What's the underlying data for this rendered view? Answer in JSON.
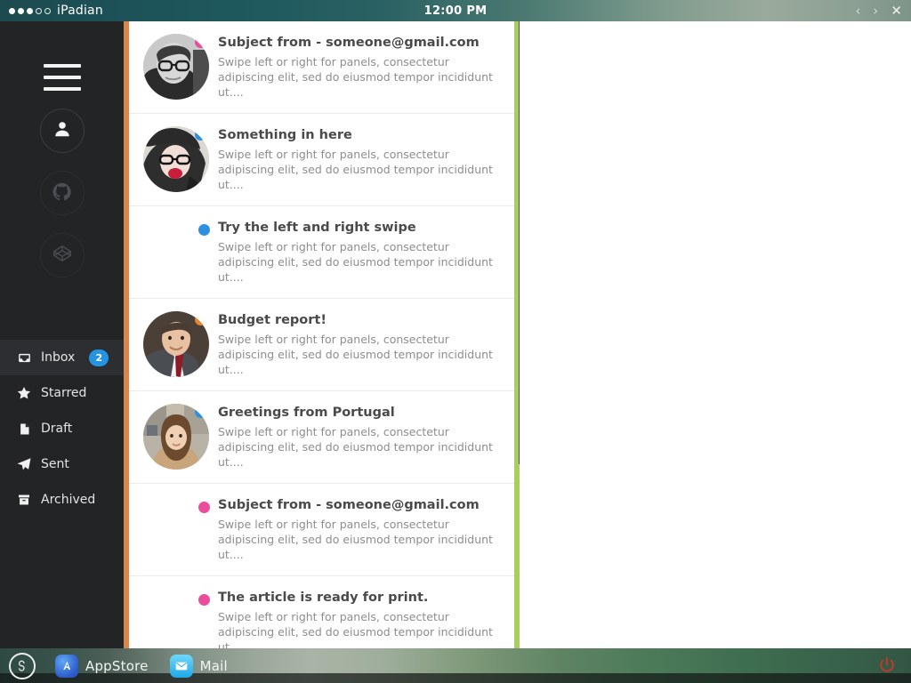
{
  "system_bar": {
    "brand": "iPadian",
    "signal_dots": [
      "on",
      "on",
      "on",
      "off",
      "off"
    ],
    "clock": "12:00 PM",
    "window_controls": [
      {
        "name": "back",
        "glyph": "‹"
      },
      {
        "name": "forward",
        "glyph": "›"
      },
      {
        "name": "close",
        "glyph": "✕"
      }
    ]
  },
  "sidebar": {
    "menu_button": "menu-icon",
    "social": [
      {
        "name": "profile",
        "icon": "user-icon",
        "active": true
      },
      {
        "name": "github",
        "icon": "github-icon",
        "active": false
      },
      {
        "name": "codepen",
        "icon": "codepen-icon",
        "active": false
      }
    ],
    "items": [
      {
        "label": "Inbox",
        "icon": "inbox-icon",
        "badge": "2",
        "active": true
      },
      {
        "label": "Starred",
        "icon": "star-icon",
        "badge": "",
        "active": false
      },
      {
        "label": "Draft",
        "icon": "document-icon",
        "badge": "",
        "active": false
      },
      {
        "label": "Sent",
        "icon": "send-icon",
        "badge": "",
        "active": false
      },
      {
        "label": "Archived",
        "icon": "archive-icon",
        "badge": "",
        "active": false
      }
    ]
  },
  "accents": {
    "orange_strip": "#dd8449",
    "green_bar": "#a8ce62",
    "scrollbar_thumb": "#4d5254",
    "badge_blue": "#2494e0"
  },
  "mail_list": {
    "preview_text": "Swipe left or right for panels, consectetur adipiscing elit, sed do eiusmod tempor incididunt ut....",
    "items": [
      {
        "subject": "Subject from - someone@gmail.com",
        "dot_color": "#ec4d9b",
        "has_avatar": true,
        "avatar": "man-with-glasses-grayscale"
      },
      {
        "subject": "Something in here",
        "dot_color": "#2d91e0",
        "has_avatar": true,
        "avatar": "woman-with-hat-red-lips"
      },
      {
        "subject": "Try the left and right swipe",
        "dot_color": "#2d91e0",
        "has_avatar": false,
        "avatar": ""
      },
      {
        "subject": "Budget report!",
        "dot_color": "#e8842c",
        "has_avatar": true,
        "avatar": "man-in-suit-with-tie"
      },
      {
        "subject": "Greetings from Portugal",
        "dot_color": "#2d91e0",
        "has_avatar": true,
        "avatar": "woman-selfie-street"
      },
      {
        "subject": "Subject from - someone@gmail.com",
        "dot_color": "#ec4d9b",
        "has_avatar": false,
        "avatar": ""
      },
      {
        "subject": "The article is ready for print.",
        "dot_color": "#ec4d9b",
        "has_avatar": false,
        "avatar": ""
      }
    ]
  },
  "taskbar": {
    "home_icon": "ipadian-logo-icon",
    "apps": [
      {
        "label": "AppStore",
        "icon": "appstore-icon"
      },
      {
        "label": "Mail",
        "icon": "mail-icon"
      }
    ],
    "power_icon": "power-icon",
    "power_color": "#c0392b"
  }
}
